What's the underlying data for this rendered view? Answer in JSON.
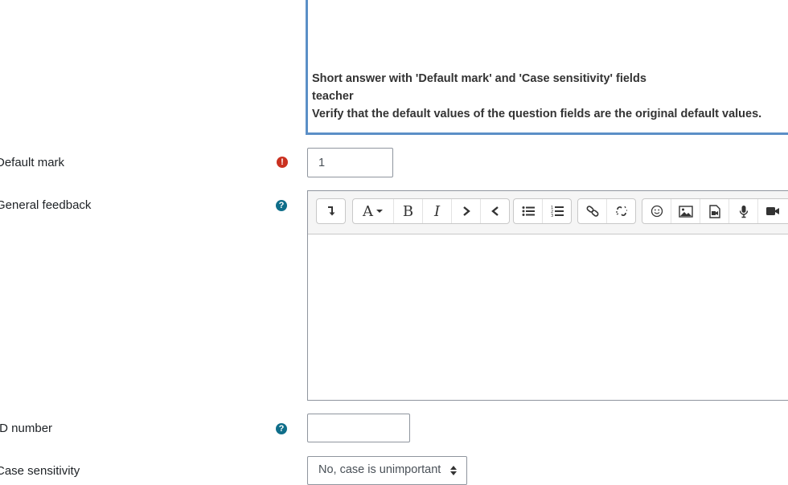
{
  "question_text": {
    "line1": "Short answer with 'Default mark' and 'Case sensitivity' fields",
    "line2": "teacher",
    "line3": "Verify that the default values of the question fields are the original default values."
  },
  "fields": {
    "default_mark": {
      "label": "Default mark",
      "value": "1"
    },
    "general_feedback": {
      "label": "General feedback",
      "content": ""
    },
    "id_number": {
      "label": "ID number",
      "value": ""
    },
    "case_sensitivity": {
      "label": "Case sensitivity",
      "selected": "No, case is unimportant"
    }
  },
  "icons": {
    "required": "!",
    "help": "?"
  },
  "toolbar": {
    "groups": [
      [
        "show-more-icon"
      ],
      [
        "font-style-icon",
        "bold-icon",
        "italic-icon",
        "indent-icon",
        "outdent-icon"
      ],
      [
        "unordered-list-icon",
        "ordered-list-icon"
      ],
      [
        "link-icon",
        "unlink-icon"
      ],
      [
        "emoji-icon",
        "image-icon",
        "media-icon",
        "record-audio-icon",
        "record-video-icon"
      ]
    ],
    "font_label": "A",
    "bold_label": "B",
    "italic_label": "I"
  },
  "colors": {
    "required_icon": "#ca3120",
    "help_icon": "#0f6e8a",
    "highlight_border": "#5b8fc7"
  }
}
